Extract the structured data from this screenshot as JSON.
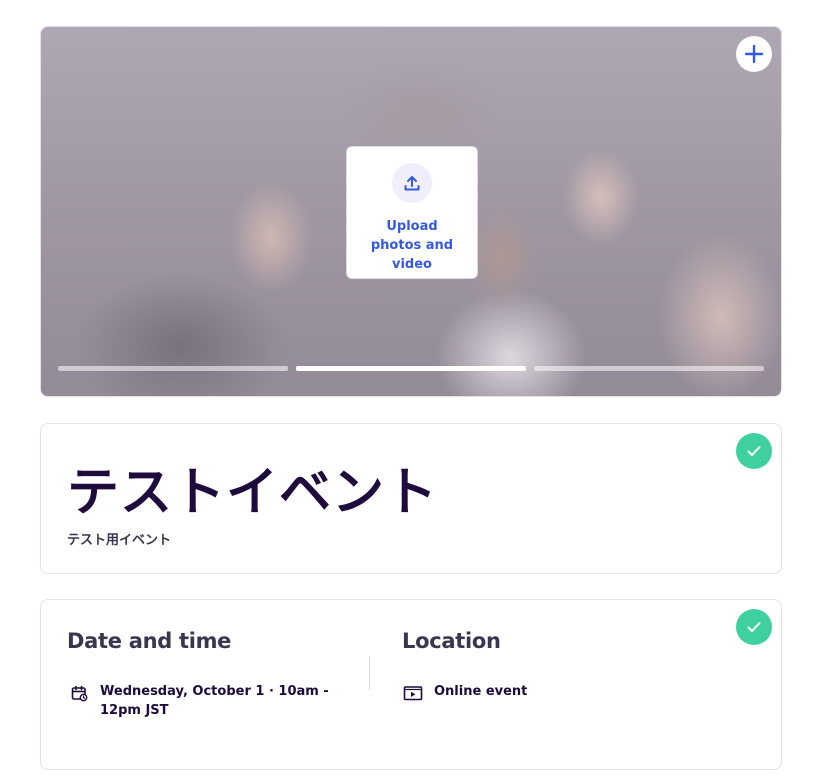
{
  "hero": {
    "add_icon": "plus-icon",
    "upload_icon": "upload-icon",
    "upload_label": "Upload photos and video",
    "slides_total": 3,
    "active_slide": 2
  },
  "event": {
    "title": "テストイベント",
    "summary": "テスト用イベント"
  },
  "date_time": {
    "heading": "Date and time",
    "icon": "calendar-icon",
    "value": "Wednesday, October 1 · 10am - 12pm JST"
  },
  "location": {
    "heading": "Location",
    "icon": "video-play-icon",
    "value": "Online event"
  },
  "colors": {
    "accent": "#3659e3",
    "success": "#3ed19d",
    "text_primary": "#1e0a3c"
  }
}
